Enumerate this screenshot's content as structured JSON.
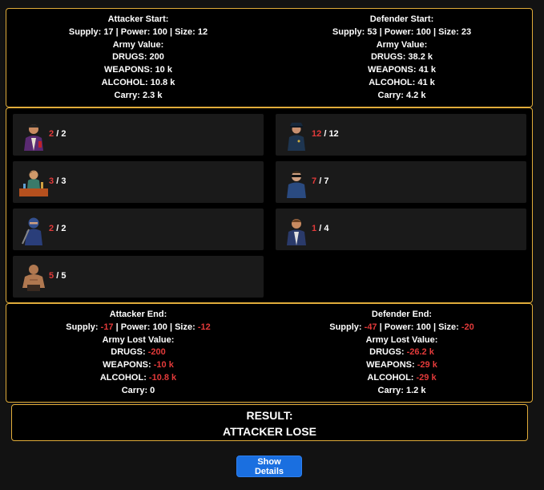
{
  "attacker_start": {
    "title": "Attacker Start:",
    "supply_label": "Supply:",
    "supply": "17",
    "power_label": "Power:",
    "power": "100",
    "size_label": "Size:",
    "size": "12",
    "army_label": "Army Value:",
    "drugs_label": "DRUGS:",
    "drugs": "200",
    "weapons_label": "WEAPONS:",
    "weapons": "10 k",
    "alcohol_label": "ALCOHOL:",
    "alcohol": "10.8 k",
    "carry_label": "Carry:",
    "carry": "2.3 k"
  },
  "defender_start": {
    "title": "Defender Start:",
    "supply_label": "Supply:",
    "supply": "53",
    "power_label": "Power:",
    "power": "100",
    "size_label": "Size:",
    "size": "23",
    "army_label": "Army Value:",
    "drugs_label": "DRUGS:",
    "drugs": "38.2 k",
    "weapons_label": "WEAPONS:",
    "weapons": "41 k",
    "alcohol_label": "ALCOHOL:",
    "alcohol": "41 k",
    "carry_label": "Carry:",
    "carry": "4.2 k"
  },
  "attacker_units": [
    {
      "icon": "pimp-portrait-icon",
      "current": "2",
      "total": "2"
    },
    {
      "icon": "bartender-portrait-icon",
      "current": "3",
      "total": "3"
    },
    {
      "icon": "ninja-portrait-icon",
      "current": "2",
      "total": "2"
    },
    {
      "icon": "brute-portrait-icon",
      "current": "5",
      "total": "5"
    }
  ],
  "defender_units": [
    {
      "icon": "police-officer-portrait-icon",
      "current": "12",
      "total": "12"
    },
    {
      "icon": "sunglasses-cop-portrait-icon",
      "current": "7",
      "total": "7"
    },
    {
      "icon": "detective-portrait-icon",
      "current": "1",
      "total": "4"
    }
  ],
  "attacker_end": {
    "title": "Attacker End:",
    "supply_label": "Supply:",
    "supply": "-17",
    "power_label": "Power:",
    "power": "100",
    "size_label": "Size:",
    "size": "-12",
    "army_label": "Army Lost Value:",
    "drugs_label": "DRUGS:",
    "drugs": "-200",
    "weapons_label": "WEAPONS:",
    "weapons": "-10 k",
    "alcohol_label": "ALCOHOL:",
    "alcohol": "-10.8 k",
    "carry_label": "Carry:",
    "carry": "0"
  },
  "defender_end": {
    "title": "Defender End:",
    "supply_label": "Supply:",
    "supply": "-47",
    "power_label": "Power:",
    "power": "100",
    "size_label": "Size:",
    "size": "-20",
    "army_label": "Army Lost Value:",
    "drugs_label": "DRUGS:",
    "drugs": "-26.2 k",
    "weapons_label": "WEAPONS:",
    "weapons": "-29 k",
    "alcohol_label": "ALCOHOL:",
    "alcohol": "-29 k",
    "carry_label": "Carry:",
    "carry": "1.2 k"
  },
  "separator": "|",
  "slash": "/",
  "result": {
    "label": "RESULT:",
    "value": "ATTACKER LOSE"
  },
  "show_details_label": "Show Details",
  "colors": {
    "border": "#e0ac3a",
    "negative": "#e33a3a",
    "button": "#1a6fe0"
  }
}
